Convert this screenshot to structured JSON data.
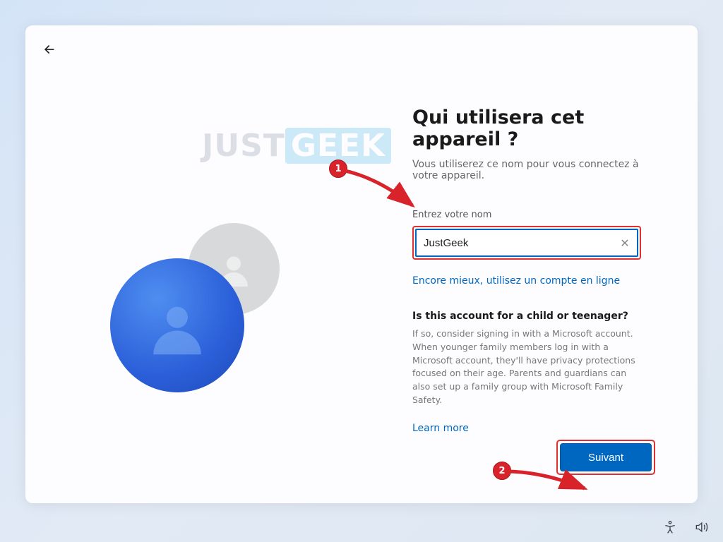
{
  "watermark": {
    "part1": "JUST",
    "part2": "GEEK"
  },
  "heading": "Qui utilisera cet appareil ?",
  "subheading": "Vous utiliserez ce nom pour vous connectez à votre appareil.",
  "name_field": {
    "label": "Entrez votre nom",
    "value": "JustGeek"
  },
  "online_link": "Encore mieux, utilisez un compte en ligne",
  "child": {
    "heading": "Is this account for a child or teenager?",
    "body": "If so, consider signing in with a Microsoft account. When younger family members log in with a Microsoft account, they'll have privacy protections focused on their age. Parents and guardians can also set up a family group with Microsoft Family Safety."
  },
  "learn_more": "Learn more",
  "next_button": "Suivant",
  "annotations": {
    "step1": "1",
    "step2": "2"
  }
}
